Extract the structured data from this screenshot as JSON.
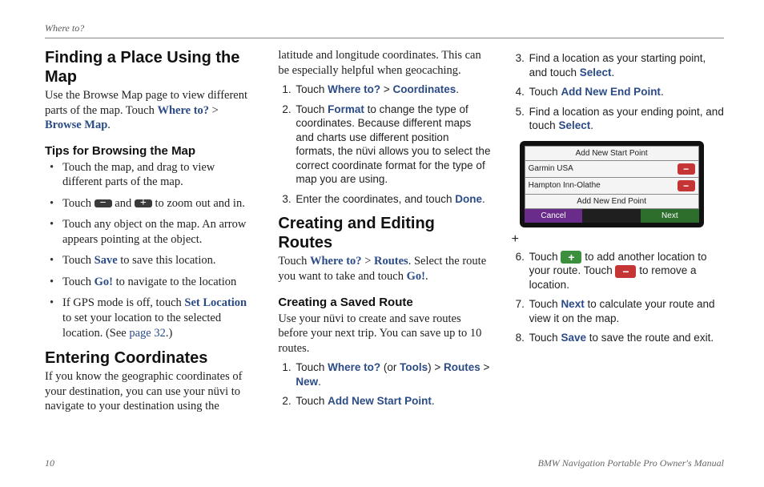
{
  "running_header": "Where to?",
  "col1": {
    "h_finding": "Finding a Place Using the Map",
    "p_finding_1a": "Use the Browse Map page to view different parts of the map. Touch ",
    "where_to": "Where to?",
    "gt": " > ",
    "browse_map": "Browse Map",
    "period": ".",
    "h_tips": "Tips for Browsing the Map",
    "tips": [
      "Touch the map, and drag to view different parts of the map.",
      "Touch ___ and ___ to zoom out and in.",
      "Touch any object on the map. An arrow appears pointing at the object."
    ],
    "tip_save_a": "Touch ",
    "save": "Save",
    "tip_save_b": " to save this location.",
    "tip_go_a": "Touch ",
    "go": "Go!",
    "tip_go_b": " to navigate to the location",
    "tip_gps_a": "If GPS mode is off, touch ",
    "set_location": "Set Location",
    "tip_gps_b": " to set your location to the selected location. (See ",
    "page32": "page 32",
    "tip_gps_c": ".)",
    "h_coords": "Entering Coordinates",
    "p_coords": "If you know the geographic coordinates of your destination, you can use your nüvi to navigate to your destination using the"
  },
  "col2": {
    "p_cont": "latitude and longitude coordinates. This can be especially helpful when geocaching.",
    "s1_a": "Touch ",
    "where_to": "Where to?",
    "gt": " > ",
    "coordinates": "Coordinates",
    "period": ".",
    "s2_a": "Touch ",
    "format": "Format",
    "s2_b": " to change the type of coordinates. Because different maps and charts use different position formats, the nüvi allows you to select the correct coordinate format for the type of map you are using.",
    "s3_a": "Enter the coordinates, and touch ",
    "done": "Done",
    "h_routes": "Creating and Editing Routes",
    "p_routes_a": "Touch ",
    "routes": "Routes",
    "p_routes_b": ". Select the route you want to take and touch ",
    "go": "Go!",
    "h_saved": "Creating a Saved Route",
    "p_saved": "Use your nüvi to create and save routes before your next trip. You can save up to 10 routes.",
    "sr1_a": "Touch ",
    "tools_paren": " (or ",
    "tools": "Tools",
    "tools_close": ") > ",
    "new": "New",
    "sr2_a": "Touch ",
    "add_start": "Add New Start Point"
  },
  "col3": {
    "s3_a": "Find a location as your starting point, and touch ",
    "select": "Select",
    "period": ".",
    "s4_a": "Touch ",
    "add_end": "Add New End Point",
    "s5_a": "Find a location as your ending point, and touch ",
    "device": {
      "r1": "Add New Start Point",
      "r2": "Garmin USA",
      "r3": "Hampton Inn-Olathe",
      "r4": "Add New End Point",
      "cancel": "Cancel",
      "next": "Next"
    },
    "s6_a": "Touch ",
    "s6_b": " to add another location to your route. Touch ",
    "s6_c": " to remove a location.",
    "s7_a": "Touch ",
    "next": "Next",
    "s7_b": " to calculate your route and view it on the map.",
    "s8_a": "Touch ",
    "save": "Save",
    "s8_b": " to save the route and exit."
  },
  "footer": {
    "page": "10",
    "title": "BMW Navigation Portable Pro Owner's Manual"
  }
}
